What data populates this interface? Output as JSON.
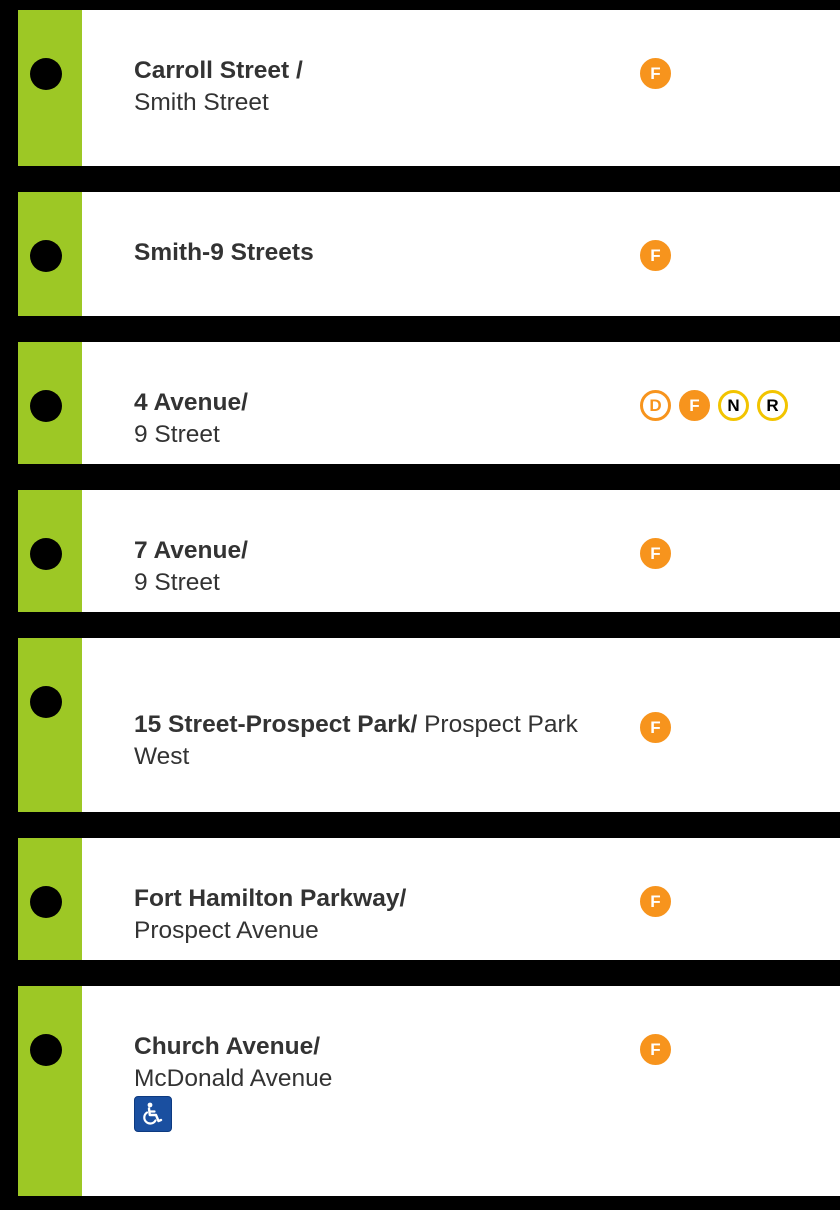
{
  "stations": [
    {
      "name_bold": "Carroll Street /",
      "name_rest": "Smith Street",
      "routes": [
        {
          "label": "F",
          "style": "orange"
        }
      ]
    },
    {
      "name_bold": "Smith-9 Streets",
      "name_rest": "",
      "routes": [
        {
          "label": "F",
          "style": "orange"
        }
      ]
    },
    {
      "name_bold": "4 Avenue/",
      "name_rest": "9 Street",
      "routes": [
        {
          "label": "D",
          "style": "orange-outline"
        },
        {
          "label": "F",
          "style": "orange"
        },
        {
          "label": "N",
          "style": "yellow-outline"
        },
        {
          "label": "R",
          "style": "yellow-outline"
        }
      ]
    },
    {
      "name_bold": "7 Avenue/",
      "name_rest": "9 Street",
      "routes": [
        {
          "label": "F",
          "style": "orange"
        }
      ]
    },
    {
      "name_bold": "15 Street-Prospect Park/",
      "name_rest": "Prospect Park West",
      "routes": [
        {
          "label": "F",
          "style": "orange"
        }
      ]
    },
    {
      "name_bold": "Fort Hamilton Parkway/",
      "name_rest": "Prospect Avenue",
      "routes": [
        {
          "label": "F",
          "style": "orange"
        }
      ]
    },
    {
      "name_bold": "Church Avenue/",
      "name_rest": "McDonald Avenue",
      "routes": [
        {
          "label": "F",
          "style": "orange"
        }
      ],
      "accessible_icon": "wheelchair-icon"
    }
  ],
  "colors": {
    "line_stripe": "#9dc825",
    "f_route": "#f7941d",
    "nr_route": "#f2c400",
    "accessible": "#1a4fa0"
  }
}
